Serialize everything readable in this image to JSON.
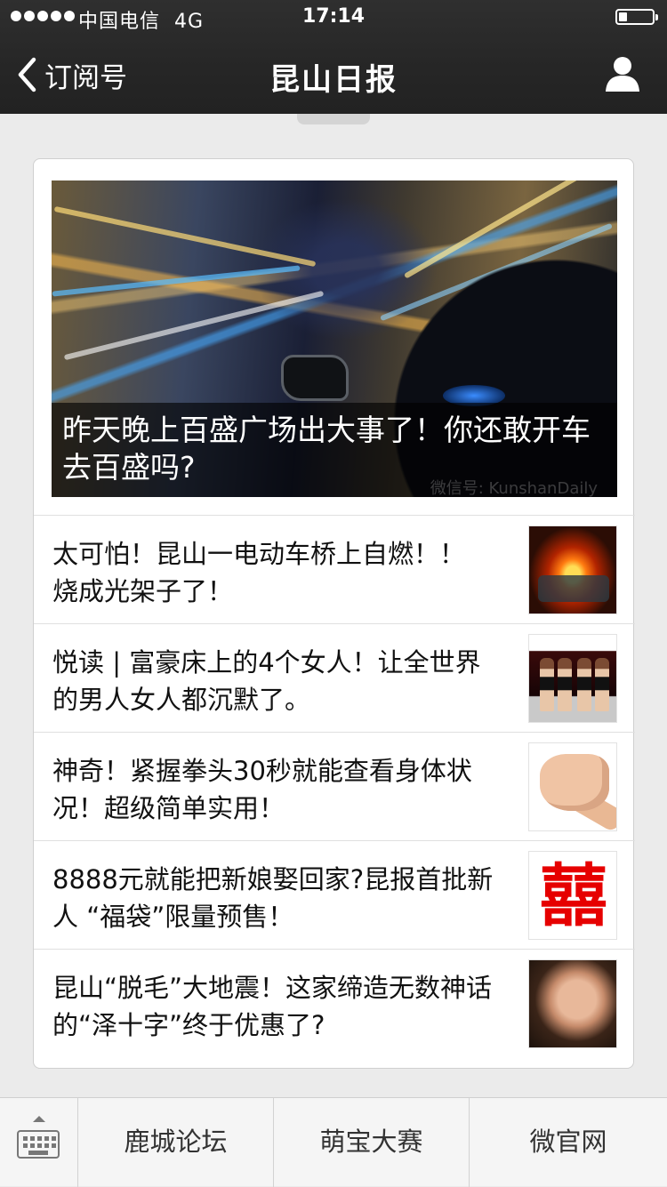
{
  "status_bar": {
    "carrier": "中国电信",
    "network": "4G",
    "time": "17:14",
    "battery_level": 0.25
  },
  "nav": {
    "back_label": "订阅号",
    "title": "昆山日报"
  },
  "featured": {
    "title": "昨天晚上百盛广场出大事了！你还敢开车去百盛吗?",
    "watermark": "微信号: KunshanDaily"
  },
  "articles": [
    {
      "title": "太可怕！昆山一电动车桥上自燃！！ 烧成光架子了！",
      "thumb": "burning-vehicle"
    },
    {
      "title": "悦读 | 富豪床上的4个女人！让全世界的男人女人都沉默了。",
      "thumb": "four-women"
    },
    {
      "title": "神奇！紧握拳头30秒就能查看身体状况！超级简单实用！",
      "thumb": "fist"
    },
    {
      "title": "8888元就能把新娘娶回家?昆报首批新人 “福袋”限量预售！",
      "thumb": "double-happiness"
    },
    {
      "title": "昆山“脱毛”大地震！这家缔造无数神话的“泽十字”终于优惠了?",
      "thumb": "woman-portrait"
    }
  ],
  "bottom_menu": {
    "items": [
      "鹿城论坛",
      "萌宝大赛",
      "微官网"
    ]
  },
  "colors": {
    "nav_bg": "#262626",
    "page_bg": "#ebebeb",
    "card_bg": "#ffffff"
  }
}
